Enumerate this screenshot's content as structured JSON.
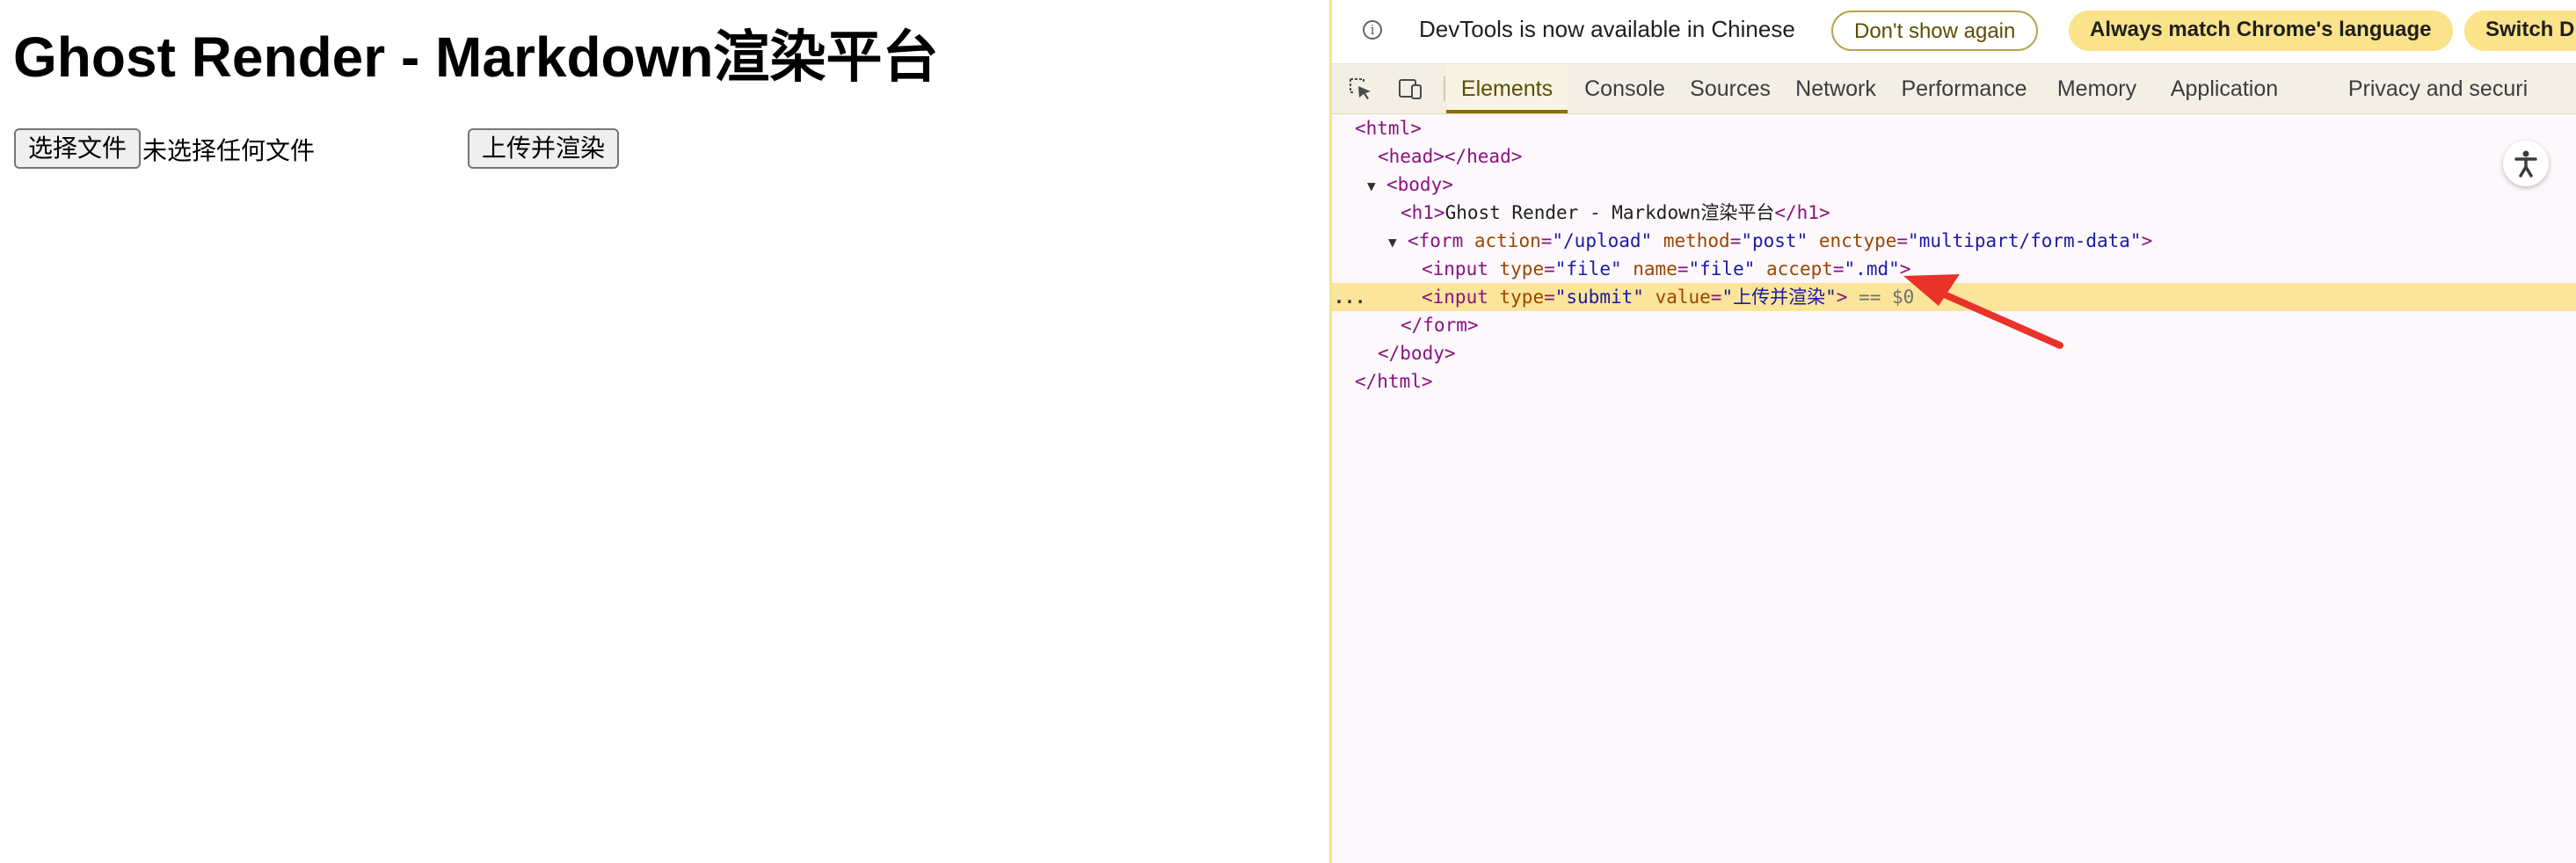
{
  "page": {
    "title": "Ghost Render - Markdown渲染平台",
    "choose_file_label": "选择文件",
    "no_file_text": "未选择任何文件",
    "submit_label": "上传并渲染"
  },
  "devtools": {
    "infobar": {
      "message": "DevTools is now available in Chinese",
      "dont_show": "Don't show again",
      "always_match": "Always match Chrome's language",
      "switch": "Switch D"
    },
    "tabs": [
      "Elements",
      "Console",
      "Sources",
      "Network",
      "Performance",
      "Memory",
      "Application",
      "Privacy and securi"
    ],
    "active_tab": "Elements",
    "dom": {
      "html_open": "<html>",
      "head": "<head></head>",
      "body_open": "<body>",
      "h1_open": "<h1>",
      "h1_text": "Ghost Render - Markdown渲染平台",
      "h1_close": "</h1>",
      "form_tag": "<form",
      "form_attrs": [
        {
          "name": "action",
          "value": "\"/upload\""
        },
        {
          "name": "method",
          "value": "\"post\""
        },
        {
          "name": "enctype",
          "value": "\"multipart/form-data\""
        }
      ],
      "input1_attrs": [
        {
          "name": "type",
          "value": "\"file\""
        },
        {
          "name": "name",
          "value": "\"file\""
        },
        {
          "name": "accept",
          "value": "\".md\""
        }
      ],
      "input2_attrs": [
        {
          "name": "type",
          "value": "\"submit\""
        },
        {
          "name": "value",
          "value": "\"上传并渲染\""
        }
      ],
      "input_tag": "<input",
      "tag_end": ">",
      "selected_marker": "== $0",
      "form_close": "</form>",
      "body_close": "</body>",
      "html_close": "</html>",
      "ellipsis": "..."
    },
    "colors": {
      "tag": "#881280",
      "attr": "#994500",
      "value": "#1a1aa6",
      "selected_row": "#fbe59a",
      "arrow": "#e8322a"
    }
  }
}
